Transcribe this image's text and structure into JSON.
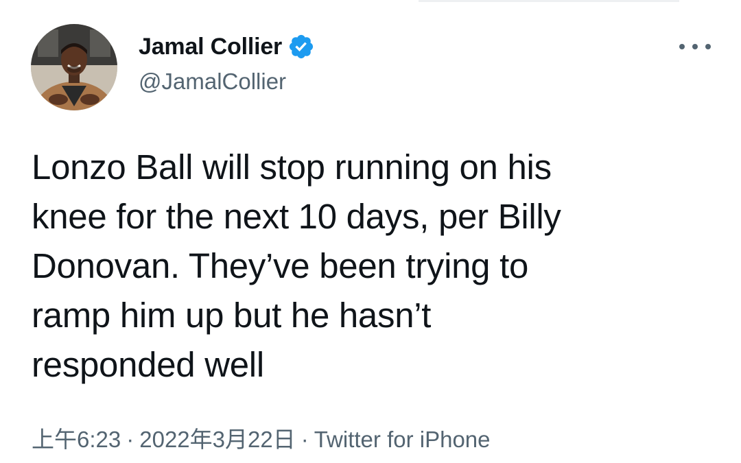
{
  "author": {
    "display_name": "Jamal Collier",
    "handle": "@JamalCollier",
    "verified": true,
    "verified_color": "#1d9bf0"
  },
  "menu": {
    "icon": "more-horizontal-icon"
  },
  "tweet": {
    "lines": [
      "Lonzo Ball will stop running on his",
      "knee for the next 10 days, per Billy",
      "Donovan. They’ve been trying to",
      "ramp him up but he hasn’t",
      "responded well"
    ]
  },
  "meta": {
    "time": "上午6:23",
    "separator": "·",
    "date": "2022年3月22日",
    "source": "Twitter for iPhone"
  },
  "colors": {
    "text_primary": "#0f1419",
    "text_secondary": "#536471",
    "background": "#ffffff"
  }
}
